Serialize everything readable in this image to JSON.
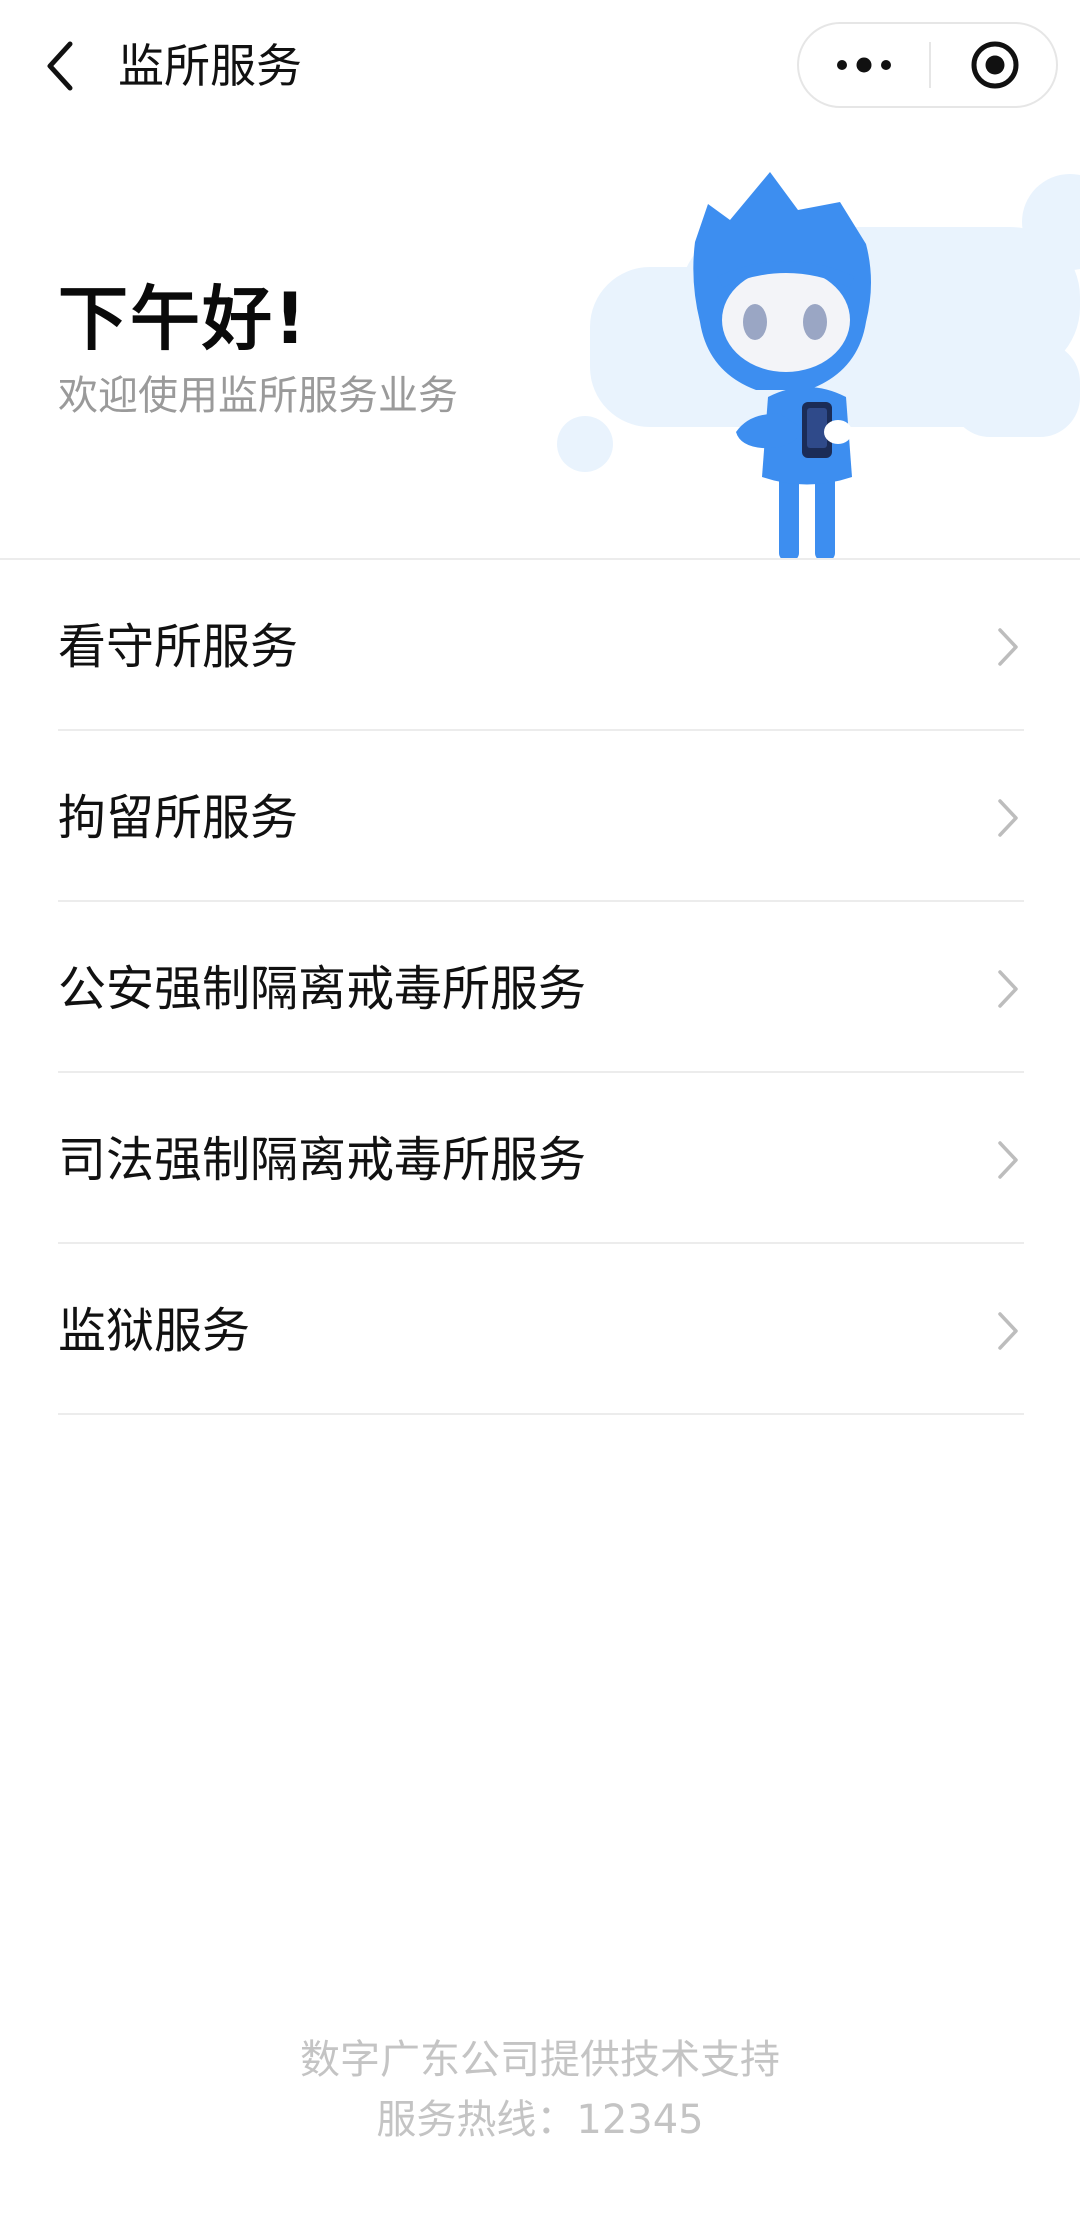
{
  "navbar": {
    "title": "监所服务",
    "back_icon": "chevron-left-icon",
    "more_icon": "more-dots-icon",
    "close_icon": "target-circle-icon"
  },
  "banner": {
    "greeting": "下午好!",
    "subtitle": "欢迎使用监所服务业务",
    "mascot": "blue-mascot-holding-phone",
    "accent_color": "#3d8ef0",
    "cloud_color": "#e9f3fd"
  },
  "services": [
    {
      "label": "看守所服务"
    },
    {
      "label": "拘留所服务"
    },
    {
      "label": "公安强制隔离戒毒所服务"
    },
    {
      "label": "司法强制隔离戒毒所服务"
    },
    {
      "label": "监狱服务"
    }
  ],
  "footer": {
    "support": "数字广东公司提供技术支持",
    "hotline": "服务热线：12345"
  }
}
